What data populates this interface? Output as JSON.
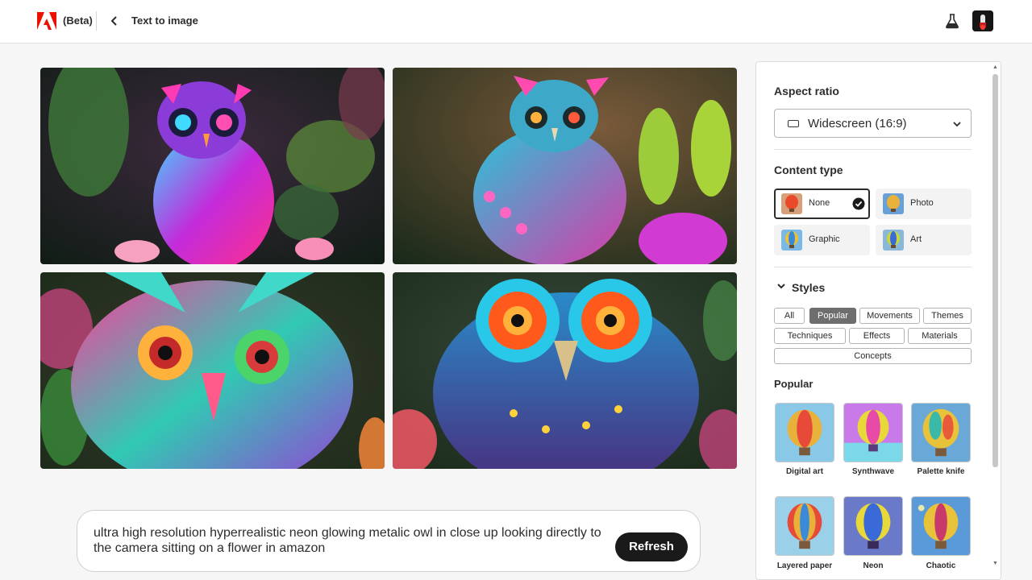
{
  "header": {
    "beta_label": "(Beta)",
    "title": "Text to image",
    "icons": [
      "adobe-logo",
      "back-chevron-icon",
      "labs-flask-icon",
      "user-avatar"
    ]
  },
  "results": {
    "images": [
      {
        "alt": "Neon owl with pink and blue feathers among leaves"
      },
      {
        "alt": "Glowing teal owl with pink feather tips"
      },
      {
        "alt": "Close-up colorful owl face in teal and pink"
      },
      {
        "alt": "Close-up owl with large glowing orange eyes"
      }
    ]
  },
  "prompt": {
    "text": "ultra high resolution hyperrealistic neon glowing metalic owl in close up looking directly to the camera sitting on a flower in amazon",
    "refresh_label": "Refresh"
  },
  "panel": {
    "aspect_ratio": {
      "heading": "Aspect ratio",
      "selected": "Widescreen (16:9)"
    },
    "content_type": {
      "heading": "Content type",
      "options": [
        {
          "label": "None",
          "selected": true
        },
        {
          "label": "Photo",
          "selected": false
        },
        {
          "label": "Graphic",
          "selected": false
        },
        {
          "label": "Art",
          "selected": false
        }
      ]
    },
    "styles": {
      "heading": "Styles",
      "chips": [
        {
          "label": "All",
          "active": false
        },
        {
          "label": "Popular",
          "active": true
        },
        {
          "label": "Movements",
          "active": false
        },
        {
          "label": "Themes",
          "active": false
        },
        {
          "label": "Techniques",
          "active": false
        },
        {
          "label": "Effects",
          "active": false
        },
        {
          "label": "Materials",
          "active": false
        },
        {
          "label": "Concepts",
          "active": false
        }
      ],
      "popular_heading": "Popular",
      "cards": [
        {
          "label": "Digital art"
        },
        {
          "label": "Synthwave"
        },
        {
          "label": "Palette knife"
        },
        {
          "label": "Layered paper"
        },
        {
          "label": "Neon"
        },
        {
          "label": "Chaotic"
        }
      ]
    }
  },
  "colors": {
    "adobe_red": "#eb1000",
    "active_chip": "#6e6e6e",
    "button_dark": "#1a1a1a"
  }
}
